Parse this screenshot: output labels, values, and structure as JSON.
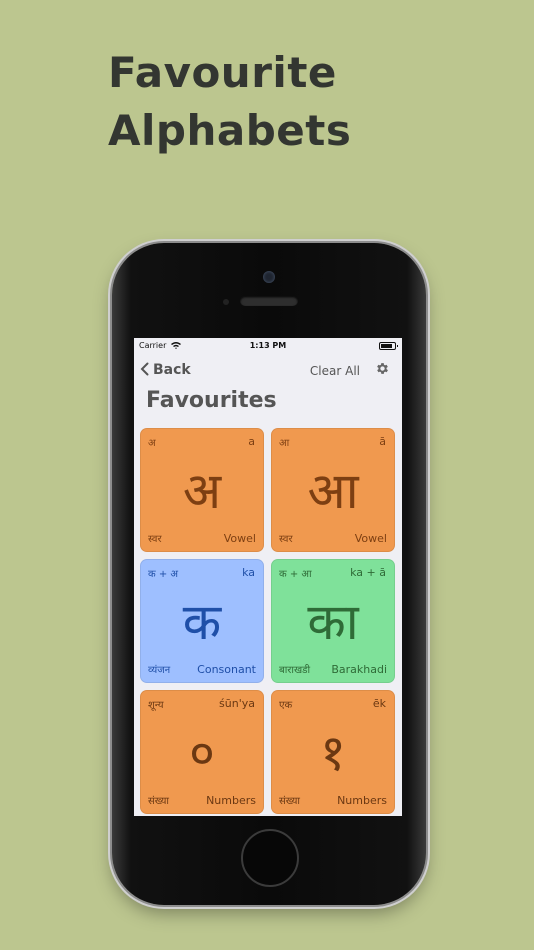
{
  "colors": {
    "background": "#bcc68f",
    "vowel_card": "#f0994f",
    "vowel_text": "#7d3f12",
    "consonant_card": "#9ebfff",
    "consonant_text": "#1f4fa8",
    "barakhadi_card": "#7fe19a",
    "barakhadi_text": "#2f6b37",
    "numbers_card": "#f0994f",
    "numbers_text": "#6b3812"
  },
  "headline": {
    "line1": "Favourite",
    "line2": "Alphabets"
  },
  "status_bar": {
    "carrier": "Carrier",
    "time": "1:13 PM"
  },
  "nav": {
    "back_label": "Back",
    "clear_label": "Clear All",
    "settings_icon": "gear-icon"
  },
  "page": {
    "title": "Favourites"
  },
  "cards": [
    {
      "top_left": "अ",
      "top_right": "a",
      "letter": "अ",
      "bottom_left": "स्वर",
      "bottom_right": "Vowel",
      "kind": "vowel"
    },
    {
      "top_left": "आ",
      "top_right": "ā",
      "letter": "आ",
      "bottom_left": "स्वर",
      "bottom_right": "Vowel",
      "kind": "vowel"
    },
    {
      "top_left": "क + अ",
      "top_right": "ka",
      "letter": "क",
      "bottom_left": "व्यंजन",
      "bottom_right": "Consonant",
      "kind": "consonant"
    },
    {
      "top_left": "क + आ",
      "top_right": "ka + ā",
      "letter": "का",
      "bottom_left": "बाराखडी",
      "bottom_right": "Barakhadi",
      "kind": "barakhadi"
    },
    {
      "top_left": "शून्य",
      "top_right": "śūn'ya",
      "letter": "०",
      "bottom_left": "संख्या",
      "bottom_right": "Numbers",
      "kind": "numbers"
    },
    {
      "top_left": "एक",
      "top_right": "ēk",
      "letter": "१",
      "bottom_left": "संख्या",
      "bottom_right": "Numbers",
      "kind": "numbers"
    }
  ]
}
